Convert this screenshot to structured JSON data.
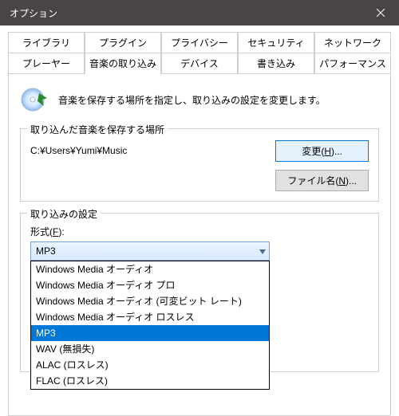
{
  "window": {
    "title": "オプション"
  },
  "tabs": {
    "row1": [
      "ライブラリ",
      "プラグイン",
      "プライバシー",
      "セキュリティ",
      "ネットワーク"
    ],
    "row2": [
      "プレーヤー",
      "音楽の取り込み",
      "デバイス",
      "書き込み",
      "パフォーマンス"
    ],
    "active": "音楽の取り込み"
  },
  "intro": {
    "text": "音楽を保存する場所を指定し、取り込みの設定を変更します。"
  },
  "storage": {
    "group_title": "取り込んだ音楽を保存する場所",
    "path": "C:¥Users¥Yumi¥Music",
    "change_btn": "変更(",
    "change_key": "H",
    "change_btn_suffix": ")...",
    "filename_btn": "ファイル名(",
    "filename_key": "N",
    "filename_btn_suffix": ")..."
  },
  "rip": {
    "group_title": "取り込みの設定",
    "format_label_prefix": "形式(",
    "format_key": "F",
    "format_label_suffix": "):",
    "selected": "MP3",
    "options": [
      "Windows Media オーディオ",
      "Windows Media オーディオ プロ",
      "Windows Media オーディオ (可変ビット レート)",
      "Windows Media オーディオ ロスレス",
      "MP3",
      "WAV (無損失)",
      "ALAC (ロスレス)",
      "FLAC (ロスレス)"
    ]
  }
}
